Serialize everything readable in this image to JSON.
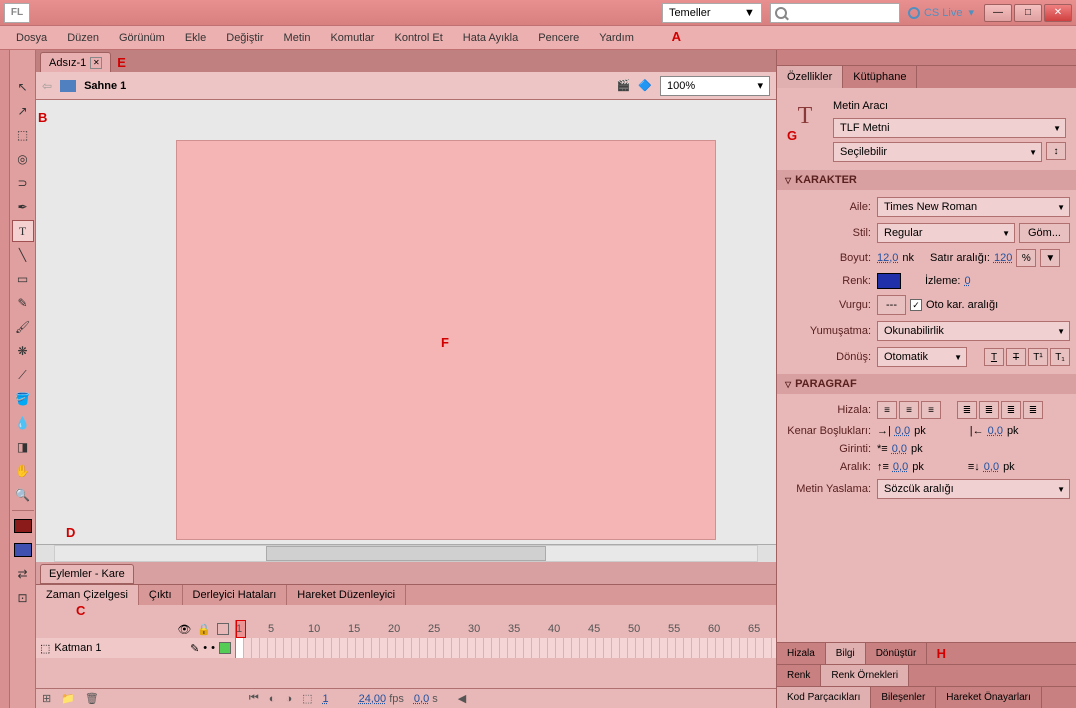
{
  "titlebar": {
    "logo": "FL",
    "workspace": "Temeller",
    "cslive": "CS Live"
  },
  "menus": [
    "Dosya",
    "Düzen",
    "Görünüm",
    "Ekle",
    "Değiştir",
    "Metin",
    "Komutlar",
    "Kontrol Et",
    "Hata Ayıkla",
    "Pencere",
    "Yardım"
  ],
  "annotations": {
    "a": "A",
    "b": "B",
    "c": "C",
    "d": "D",
    "e": "E",
    "f": "F",
    "g": "G",
    "h": "H"
  },
  "doc": {
    "name": "Adsız-1",
    "scene": "Sahne 1",
    "zoom": "100%"
  },
  "actions_tab": "Eylemler - Kare",
  "bottom_tabs": [
    "Zaman Çizelgesi",
    "Çıktı",
    "Derleyici Hataları",
    "Hareket Düzenleyici"
  ],
  "timeline": {
    "layer": "Katman 1",
    "ruler": [
      1,
      5,
      10,
      15,
      20,
      25,
      30,
      35,
      40,
      45,
      50,
      55,
      60,
      65
    ],
    "fps": "24,00",
    "fps_unit": "fps",
    "time": "0,0",
    "time_unit": "s",
    "frame": "1"
  },
  "right": {
    "tabs": [
      "Özellikler",
      "Kütüphane"
    ],
    "tool_name": "Metin Aracı",
    "text_type": "TLF Metni",
    "selectable": "Seçilebilir",
    "sec_char": "KARAKTER",
    "family_lbl": "Aile:",
    "family": "Times New Roman",
    "style_lbl": "Stil:",
    "style": "Regular",
    "embed": "Göm...",
    "size_lbl": "Boyut:",
    "size": "12,0",
    "size_unit": "nk",
    "leading_lbl": "Satır aralığı:",
    "leading": "120",
    "leading_unit": "%",
    "color_lbl": "Renk:",
    "track_lbl": "İzleme:",
    "track": "0",
    "highlight_lbl": "Vurgu:",
    "highlight": "---",
    "autokern": "Oto kar. aralığı",
    "aa_lbl": "Yumuşatma:",
    "aa": "Okunabilirlik",
    "rotate_lbl": "Dönüş:",
    "rotate": "Otomatik",
    "sec_para": "PARAGRAF",
    "align_lbl": "Hizala:",
    "margins_lbl": "Kenar Boşlukları:",
    "margin_l": "0,0",
    "margin_r": "0,0",
    "pk": "pk",
    "indent_lbl": "Girinti:",
    "indent": "0,0",
    "space_lbl": "Aralık:",
    "space_b": "0,0",
    "space_a": "0,0",
    "justify_lbl": "Metin Yaslama:",
    "justify": "Sözcük aralığı",
    "mini1": [
      "Hizala",
      "Bilgi",
      "Dönüştür"
    ],
    "mini2": [
      "Renk",
      "Renk Örnekleri"
    ],
    "mini3": [
      "Kod Parçacıkları",
      "Bileşenler",
      "Hareket Önayarları"
    ]
  },
  "colors": {
    "stage": "#f5b5b5",
    "fill": "#2030a8",
    "stroke": "#8b1a1a"
  }
}
